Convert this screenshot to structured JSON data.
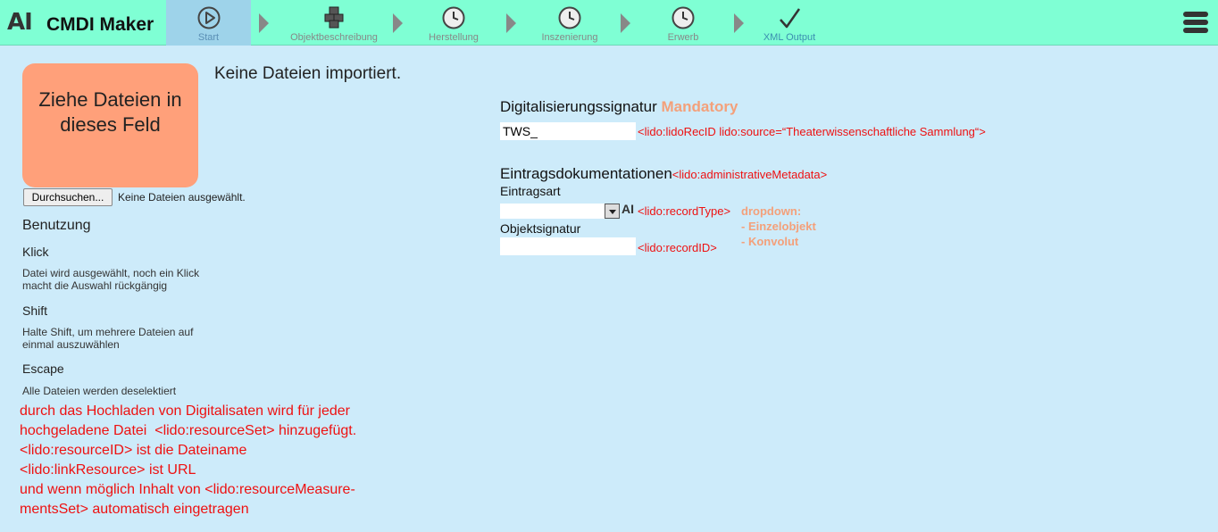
{
  "header": {
    "logo_text": "AI",
    "app_title": "CMDI Maker",
    "steps": [
      {
        "label": "Start",
        "icon": "play-icon"
      },
      {
        "label": "Objektbeschreibung",
        "icon": "cubes-icon"
      },
      {
        "label": "Herstellung",
        "icon": "clock-icon"
      },
      {
        "label": "Inszenierung",
        "icon": "clock-icon"
      },
      {
        "label": "Erwerb",
        "icon": "clock-icon"
      },
      {
        "label": "XML Output",
        "icon": "checkmark-icon"
      }
    ],
    "menu_icon": "hamburger-menu-icon"
  },
  "files": {
    "dropzone_text": "Ziehe Dateien in dieses Feld",
    "browse_label": "Durchsuchen...",
    "browse_status": "Keine Dateien ausgewählt.",
    "no_files_imported": "Keine Dateien importiert."
  },
  "usage": {
    "title": "Benutzung",
    "items": [
      {
        "key": "Klick",
        "desc": "Datei wird ausgewählt, noch ein Klick macht die Auswahl rückgängig"
      },
      {
        "key": "Shift",
        "desc": "Halte Shift, um mehrere Dateien auf einmal auszuwählen"
      },
      {
        "key": "Escape",
        "desc": "Alle Dateien werden deselektiert"
      }
    ]
  },
  "note_lines": [
    "durch das Hochladen von Digitalisaten wird für jeder",
    "hochgeladene Datei  <lido:resourceSet> hinzugefügt.",
    "<lido:resourceID> ist die Dateiname",
    "<lido:linkResource> ist URL",
    "und wenn möglich Inhalt von <lido:resourceMeasure-",
    "mentsSet> automatisch eingetragen"
  ],
  "form": {
    "sig_title": "Digitalisierungssignatur",
    "sig_mandatory": "Mandatory",
    "sig_value": "TWS_",
    "sig_lido": "<lido:lidoRecID lido:source=“Theaterwissenschaftliche Sammlung“>",
    "entries_title": "Eintragsdokumentationen",
    "entries_lido": "<lido:administrativeMetadata>",
    "record_type_label": "Eintragsart",
    "record_type_value": "",
    "record_type_lido": "<lido:recordType>",
    "record_type_ai": "AI",
    "dropdown_note": [
      "dropdown:",
      "- Einzelobjekt",
      "- Konvolut"
    ],
    "object_sig_label": "Objektsignatur",
    "object_sig_value": "",
    "object_sig_lido": "<lido:recordID>"
  },
  "colors": {
    "topbar": "#7fffd4",
    "background": "#cdebfa",
    "dropzone": "#ffa07a",
    "accent_red": "#ee1111",
    "mandatory": "#f4a07a"
  }
}
